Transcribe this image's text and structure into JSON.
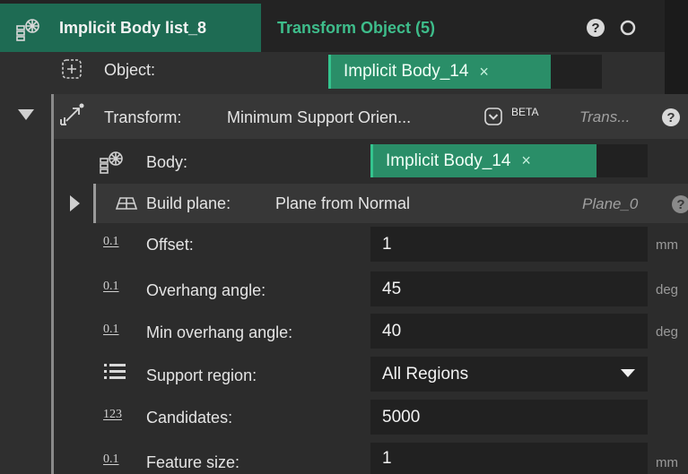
{
  "tabs": {
    "active": "Implicit Body list_8",
    "secondary": "Transform Object (5)"
  },
  "header_icons": {
    "help": "help-icon",
    "circle": "circle-icon"
  },
  "object": {
    "label": "Object:",
    "value": "Implicit Body_14",
    "remove": "×"
  },
  "transform": {
    "label": "Transform:",
    "method": "Minimum Support Orien...",
    "badge": "BETA",
    "output": "Trans...",
    "help": "?"
  },
  "body": {
    "label": "Body:",
    "value": "Implicit Body_14",
    "remove": "×"
  },
  "build_plane": {
    "label": "Build plane:",
    "method": "Plane from Normal",
    "output": "Plane_0"
  },
  "params": [
    {
      "icon_text": "0.1",
      "label": "Offset:",
      "value": "1",
      "unit": "mm"
    },
    {
      "icon_text": "0.1",
      "label": "Overhang angle:",
      "value": "45",
      "unit": "deg"
    },
    {
      "icon_text": "0.1",
      "label": "Min overhang angle:",
      "value": "40",
      "unit": "deg"
    },
    {
      "icon_text": "",
      "label": "Support region:",
      "value": "All Regions",
      "unit": ""
    },
    {
      "icon_text": "123",
      "label": "Candidates:",
      "value": "5000",
      "unit": ""
    },
    {
      "icon_text": "0.1",
      "label": "Feature size:",
      "value": "1",
      "unit": "mm"
    }
  ],
  "colors": {
    "accent_green": "#2a8e68",
    "tab_green": "#1e6b53",
    "panel": "#2f2f2f",
    "field": "#212121"
  }
}
